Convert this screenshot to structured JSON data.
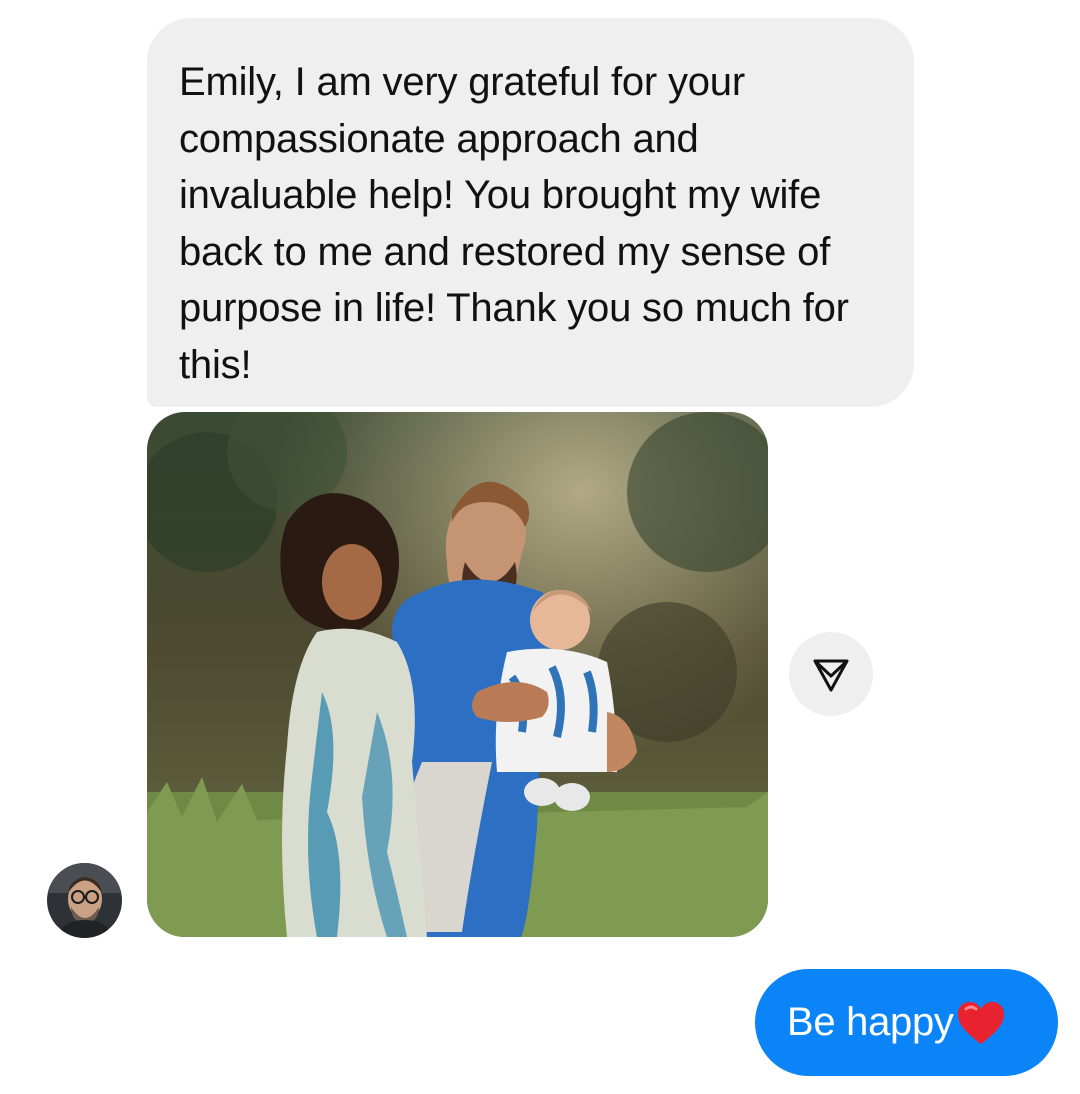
{
  "thread": {
    "incoming_message": "Emily, I am very grateful for your compassionate approach and invaluable help! You brought my wife back to me and restored my sense of purpose in life! Thank you so much for this!",
    "photo_icon": "family-photo",
    "share_icon": "paper-plane-icon",
    "sender_avatar_icon": "avatar",
    "outgoing_message": "Be happy",
    "outgoing_emoji": "heart-emoji",
    "colors": {
      "incoming_bubble": "#efefef",
      "outgoing_bubble": "#0a84f7",
      "heart": "#e8222f"
    }
  }
}
